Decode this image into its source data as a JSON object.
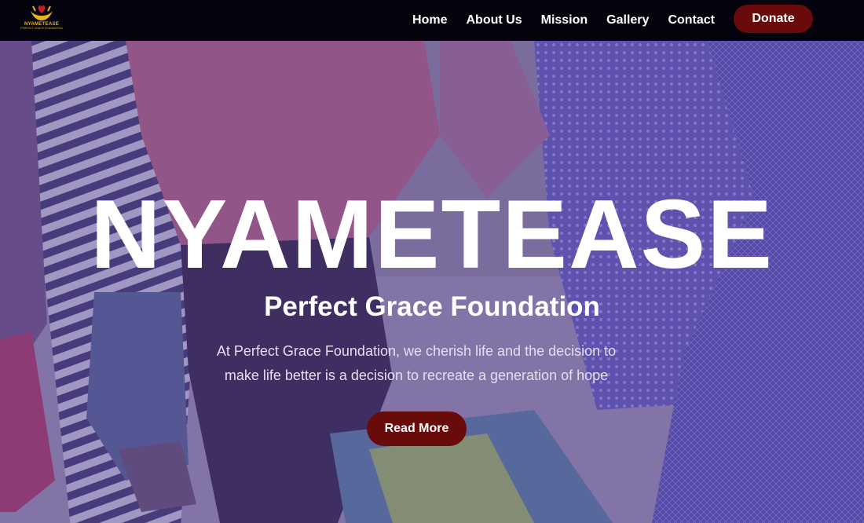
{
  "brand": {
    "name": "NYAMETEASE",
    "tagline": "PERFECT GRACE FOUNDATION",
    "logo_icon": "hands-heart-icon"
  },
  "nav": {
    "items": [
      {
        "label": "Home"
      },
      {
        "label": "About Us"
      },
      {
        "label": "Mission"
      },
      {
        "label": "Gallery"
      },
      {
        "label": "Contact"
      }
    ],
    "donate_label": "Donate"
  },
  "hero": {
    "title": "NYAMETEASE",
    "subtitle": "Perfect Grace Foundation",
    "description": "At Perfect Grace Foundation, we cherish life and the decision to make life better is a decision to recreate a generation of hope",
    "cta_label": "Read More"
  },
  "colors": {
    "navbar_bg": "#05030d",
    "button_bg": "#6a0b0b",
    "overlay": "#48348c",
    "logo_gold": "#e8b21c"
  }
}
